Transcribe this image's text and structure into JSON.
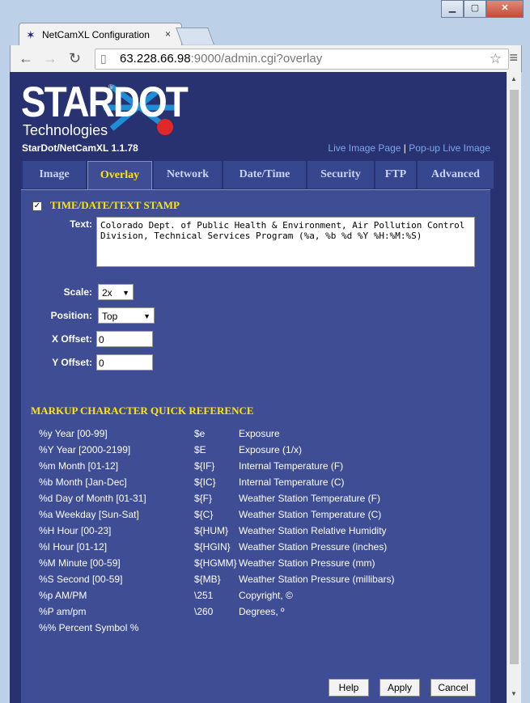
{
  "browser": {
    "tab_title": "NetCamXL Configuration",
    "tab_close": "×",
    "url_host": "63.228.66.98",
    "url_rest": ":9000/admin.cgi?overlay"
  },
  "page": {
    "logo_word": "STARDOT",
    "logo_reg": "®",
    "logo_sub": "Technologies",
    "version": "StarDot/NetCamXL 1.1.78",
    "link_live": "Live Image Page",
    "link_sep": "|",
    "link_popup": "Pop-up Live Image",
    "tabs": [
      "Image",
      "Overlay",
      "Network",
      "Date/Time",
      "Security",
      "FTP",
      "Advanced"
    ],
    "active_tab": "Overlay"
  },
  "overlay": {
    "section_title": "TIME/DATE/TEXT STAMP",
    "checked": "✓",
    "text_label": "Text:",
    "text_value": "Colorado Dept. of Public Health & Environment, Air Pollution Control Division, Technical Services Program (%a, %b %d %Y %H:%M:%S)",
    "scale_label": "Scale:",
    "scale_value": "2x",
    "position_label": "Position:",
    "position_value": "Top",
    "xoffset_label": "X Offset:",
    "xoffset_value": "0",
    "yoffset_label": "Y Offset:",
    "yoffset_value": "0"
  },
  "reference": {
    "title": "MARKUP CHARACTER QUICK REFERENCE",
    "rows": [
      [
        "%y  Year [00-99]",
        "$e",
        "Exposure"
      ],
      [
        "%Y  Year [2000-2199]",
        "$E",
        "Exposure (1/x)"
      ],
      [
        "%m  Month [01-12]",
        "${IF}",
        "Internal Temperature (F)"
      ],
      [
        "%b  Month [Jan-Dec]",
        "${IC}",
        "Internal Temperature (C)"
      ],
      [
        "%d  Day of Month [01-31]",
        "${F}",
        "Weather Station Temperature (F)"
      ],
      [
        "%a  Weekday [Sun-Sat]",
        "${C}",
        "Weather Station Temperature (C)"
      ],
      [
        "%H  Hour [00-23]",
        "${HUM}",
        "Weather Station Relative Humidity"
      ],
      [
        "%I   Hour [01-12]",
        "${HGIN}",
        "Weather Station Pressure (inches)"
      ],
      [
        "%M  Minute [00-59]",
        "${HGMM}",
        "Weather Station Pressure (mm)"
      ],
      [
        "%S  Second [00-59]",
        "${MB}",
        "Weather Station Pressure (millibars)"
      ],
      [
        "%p  AM/PM",
        "\\251",
        "Copyright, ©"
      ],
      [
        "%P  am/pm",
        "\\260",
        "Degrees, º"
      ],
      [
        "%% Percent Symbol %",
        "",
        ""
      ]
    ]
  },
  "buttons": {
    "help": "Help",
    "apply": "Apply",
    "cancel": "Cancel"
  },
  "icons": {
    "favicon": "starburst-icon",
    "back": "back-arrow-icon",
    "forward": "forward-arrow-icon",
    "reload": "reload-icon",
    "page": "page-icon",
    "star": "star-icon",
    "menu": "hamburger-menu-icon"
  }
}
